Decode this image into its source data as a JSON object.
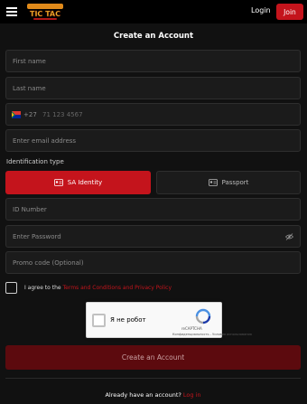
{
  "header": {
    "logo_text": "TIC TAC",
    "login_label": "Login",
    "join_label": "Join"
  },
  "form": {
    "title": "Create an Account",
    "first_name_placeholder": "First name",
    "last_name_placeholder": "Last name",
    "phone_prefix": "+27",
    "phone_placeholder": "71 123 4567",
    "email_placeholder": "Enter email address",
    "id_type_label": "Identification type",
    "id_type_options": [
      {
        "label": "SA Identity",
        "selected": true
      },
      {
        "label": "Passport",
        "selected": false
      }
    ],
    "id_number_placeholder": "ID Number",
    "password_placeholder": "Enter Password",
    "promo_placeholder": "Promo code (Optional)",
    "terms_prefix": "I agree to the",
    "terms_link": "Terms and Conditions and Privacy Policy",
    "captcha_label": "Я не робот",
    "captcha_brand": "reCAPTCHA",
    "captcha_privacy": "Конфиденциальность - Условия использования",
    "submit_label": "Create an Account",
    "already_text": "Already have an account?",
    "login_link": "Log in"
  },
  "colors": {
    "accent": "#c4141c",
    "background": "#111111",
    "field_bg": "#1b1b1b"
  }
}
